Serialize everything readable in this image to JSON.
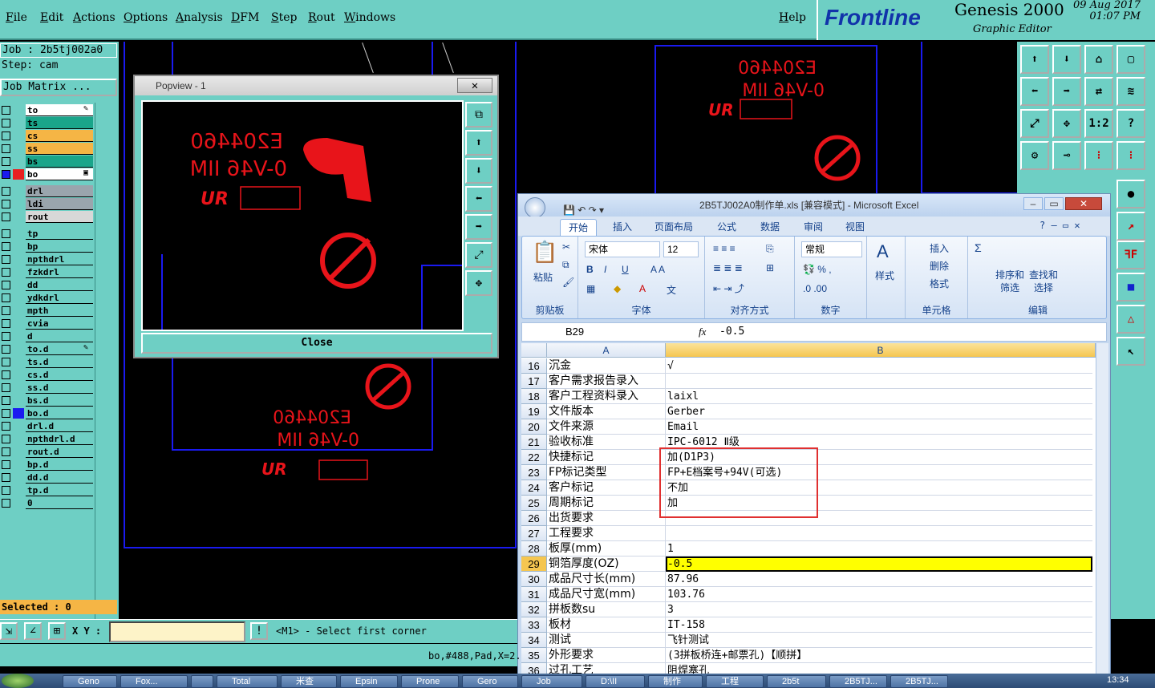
{
  "menubar": {
    "items": [
      "File",
      "Edit",
      "Actions",
      "Options",
      "Analysis",
      "DFM",
      "Step",
      "Rout",
      "Windows"
    ],
    "help": "Help"
  },
  "brand": {
    "logo": "Frontline",
    "product": "Genesis 2000",
    "subtitle": "Graphic Editor",
    "date": "09 Aug 2017",
    "time": "01:07 PM"
  },
  "job": {
    "job_line": "Job : 2b5tj002a0",
    "step_line": "Step: cam",
    "matrix_button": "Job Matrix ..."
  },
  "layers": [
    {
      "name": "to",
      "color": "#ffffff",
      "mark": "✎"
    },
    {
      "name": "ts",
      "color": "#1aa58a",
      "mark": ""
    },
    {
      "name": "cs",
      "color": "#f5b545",
      "mark": ""
    },
    {
      "name": "ss",
      "color": "#f5b545",
      "mark": ""
    },
    {
      "name": "bs",
      "color": "#1aa58a",
      "mark": ""
    },
    {
      "name": "bo",
      "color": "#ffffff",
      "mark": "▣"
    },
    {
      "name": "drl",
      "color": "#9aa5ad",
      "mark": ""
    },
    {
      "name": "ldi",
      "color": "#9aa5ad",
      "mark": ""
    },
    {
      "name": "rout",
      "color": "#d8d8d8",
      "mark": ""
    },
    {
      "name": "tp",
      "color": "#6ecfc4",
      "mark": ""
    },
    {
      "name": "bp",
      "color": "#6ecfc4",
      "mark": ""
    },
    {
      "name": "npthdrl",
      "color": "#6ecfc4",
      "mark": ""
    },
    {
      "name": "fzkdrl",
      "color": "#6ecfc4",
      "mark": ""
    },
    {
      "name": "dd",
      "color": "#6ecfc4",
      "mark": ""
    },
    {
      "name": "ydkdrl",
      "color": "#6ecfc4",
      "mark": ""
    },
    {
      "name": "mpth",
      "color": "#6ecfc4",
      "mark": ""
    },
    {
      "name": "cvia",
      "color": "#6ecfc4",
      "mark": ""
    },
    {
      "name": "d",
      "color": "#6ecfc4",
      "mark": ""
    },
    {
      "name": "to.d",
      "color": "#6ecfc4",
      "mark": "✎"
    },
    {
      "name": "ts.d",
      "color": "#6ecfc4",
      "mark": ""
    },
    {
      "name": "cs.d",
      "color": "#6ecfc4",
      "mark": ""
    },
    {
      "name": "ss.d",
      "color": "#6ecfc4",
      "mark": ""
    },
    {
      "name": "bs.d",
      "color": "#6ecfc4",
      "mark": ""
    },
    {
      "name": "bo.d",
      "color": "#6ecfc4",
      "mark": ""
    },
    {
      "name": "drl.d",
      "color": "#6ecfc4",
      "mark": ""
    },
    {
      "name": "npthdrl.d",
      "color": "#6ecfc4",
      "mark": ""
    },
    {
      "name": "rout.d",
      "color": "#6ecfc4",
      "mark": ""
    },
    {
      "name": "bp.d",
      "color": "#6ecfc4",
      "mark": ""
    },
    {
      "name": "dd.d",
      "color": "#6ecfc4",
      "mark": ""
    },
    {
      "name": "tp.d",
      "color": "#6ecfc4",
      "mark": ""
    },
    {
      "name": "0",
      "color": "#6ecfc4",
      "mark": ""
    }
  ],
  "status": {
    "selected": "Selected : 0",
    "xy_label": "X Y :",
    "xy_value": "",
    "prompt": "<M1> - Select first corner",
    "feature_info": "bo,#488,Pad,X=2."
  },
  "popview": {
    "title": "Popview - 1",
    "close_label": "Close",
    "marking_lines": [
      "E204460",
      "0-V46 IIM"
    ]
  },
  "excel": {
    "title": "2B5TJ002A0制作单.xls  [兼容模式] - Microsoft Excel",
    "tabs": [
      "开始",
      "插入",
      "页面布局",
      "公式",
      "数据",
      "审阅",
      "视图"
    ],
    "ribbon": {
      "paste": "粘贴",
      "clipboard": "剪贴板",
      "font_name": "宋体",
      "font_size": "12",
      "font_group": "字体",
      "align_group": "对齐方式",
      "number_format": "常规",
      "number_group": "数字",
      "style": "样式",
      "insert": "插入",
      "delete": "删除",
      "format": "格式",
      "cells_group": "单元格",
      "sort": "排序和\n筛选",
      "find": "查找和\n选择",
      "edit_group": "编辑"
    },
    "name_box": "B29",
    "fx": "fx",
    "formula_value": "-0.5",
    "col_a": "A",
    "col_b": "B",
    "rows": [
      {
        "n": "16",
        "a": "沉金",
        "b": "√"
      },
      {
        "n": "17",
        "a": "客户需求报告录入",
        "b": ""
      },
      {
        "n": "18",
        "a": "客户工程资料录入",
        "b": "laixl"
      },
      {
        "n": "19",
        "a": "文件版本",
        "b": "Gerber"
      },
      {
        "n": "20",
        "a": "文件来源",
        "b": "Email"
      },
      {
        "n": "21",
        "a": "验收标准",
        "b": "IPC-6012 Ⅱ级"
      },
      {
        "n": "22",
        "a": "快捷标记",
        "b": "加(D1P3)"
      },
      {
        "n": "23",
        "a": "FP标记类型",
        "b": "FP+E档案号+94V(可选)"
      },
      {
        "n": "24",
        "a": "客户标记",
        "b": "不加"
      },
      {
        "n": "25",
        "a": "周期标记",
        "b": "加"
      },
      {
        "n": "26",
        "a": "出货要求",
        "b": ""
      },
      {
        "n": "27",
        "a": "工程要求",
        "b": ""
      },
      {
        "n": "28",
        "a": "板厚(mm)",
        "b": "1"
      },
      {
        "n": "29",
        "a": "铜箔厚度(OZ)",
        "b": "-0.5"
      },
      {
        "n": "30",
        "a": "成品尺寸长(mm)",
        "b": "87.96"
      },
      {
        "n": "31",
        "a": "成品尺寸宽(mm)",
        "b": "103.76"
      },
      {
        "n": "32",
        "a": "拼板数su",
        "b": "3"
      },
      {
        "n": "33",
        "a": "板材",
        "b": "IT-158"
      },
      {
        "n": "34",
        "a": "测试",
        "b": "飞针测试"
      },
      {
        "n": "35",
        "a": "外形要求",
        "b": "(3拼板桥连+邮票孔)【顺拼】"
      },
      {
        "n": "36",
        "a": "过孔工艺",
        "b": "阻焊塞孔"
      }
    ]
  },
  "right_toolbar_labels": [
    "1:2",
    "?"
  ],
  "taskbar": {
    "items": [
      "Geno",
      "Fox...",
      "",
      "Total",
      "米查",
      "Epsin",
      "Prone",
      "Gero",
      "Job",
      "D:\\II",
      "制作",
      "工程",
      "2b5t",
      "2B5TJ...",
      "2B5TJ..."
    ],
    "clock": "13:34"
  }
}
